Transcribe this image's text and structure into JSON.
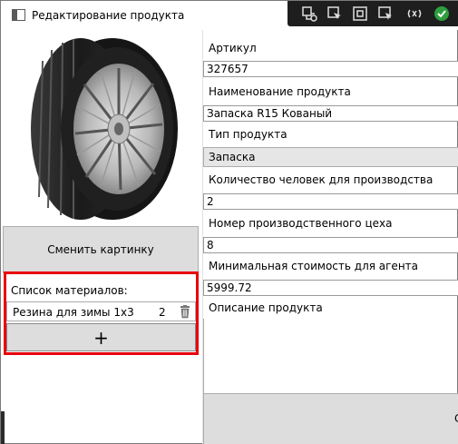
{
  "window": {
    "title": "Редактирование продукта"
  },
  "toolbar": {
    "icons": [
      "live-tree-icon",
      "select-element-icon",
      "display-layout-adorners-icon",
      "track-focused-element-icon",
      "hot-reload-icon",
      "binding-ok-icon"
    ]
  },
  "image_panel": {
    "change_button_label": "Сменить картинку"
  },
  "materials": {
    "label": "Список материалов:",
    "items": [
      {
        "name": "Резина для зимы 1х3",
        "count": "2"
      }
    ],
    "add_button_label": "+",
    "highlight_color": "#e8000a"
  },
  "form": {
    "article_label": "Артикул",
    "article_value": "327657",
    "name_label": "Наименование продукта",
    "name_value": "Запаска R15 Кованый",
    "type_label": "Тип продукта",
    "type_value": "Запаска",
    "people_label": "Количество человек для производства",
    "people_value": "2",
    "workshop_label": "Номер производственного цеха",
    "workshop_value": "8",
    "min_cost_label": "Минимальная стоимость для агента",
    "min_cost_value": "5999.72",
    "description_label": "Описание продукта",
    "save_button_label": "С"
  }
}
